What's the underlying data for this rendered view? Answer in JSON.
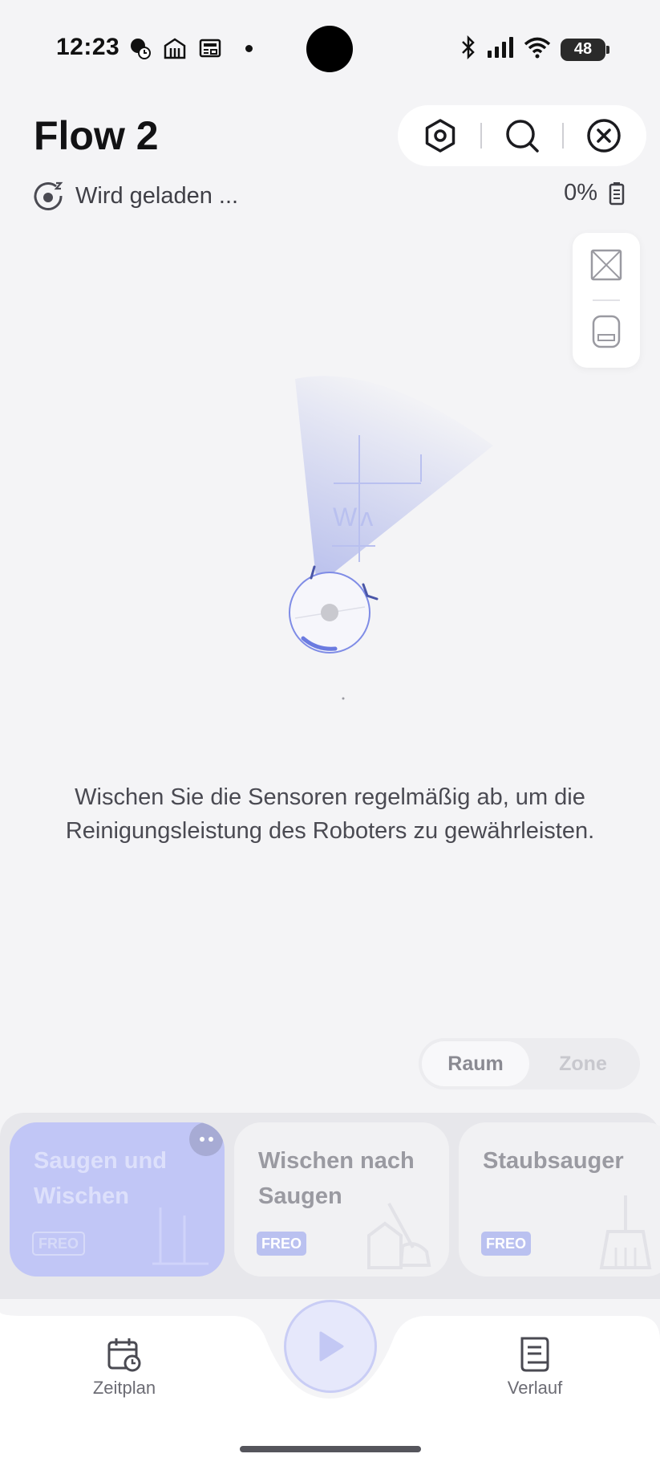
{
  "status_bar": {
    "time": "12:23",
    "battery_level": "48",
    "icons": [
      "notification-app-icon",
      "restaurant-app-icon",
      "news-app-icon",
      "bluetooth-icon",
      "cellular-signal-icon",
      "wifi-icon"
    ]
  },
  "header": {
    "title": "Flow 2",
    "status_text": "Wird geladen ...",
    "battery_percent": "0%",
    "actions": [
      "settings-icon",
      "search-icon",
      "close-icon"
    ]
  },
  "map": {
    "robot_accent": "#6b7be0",
    "scan_label": "Wʌ"
  },
  "tip": {
    "text": "Wischen Sie die Sensoren regelmäßig ab, um die Reinigungsleistung des Roboters zu gewährleisten."
  },
  "mode_toggle": {
    "options": [
      "Raum",
      "Zone"
    ],
    "selected": "Raum"
  },
  "cards": [
    {
      "title": "Saugen und Wischen",
      "badge": "FREO",
      "selected": true
    },
    {
      "title": "Wischen nach Saugen",
      "badge": "FREO",
      "selected": false
    },
    {
      "title": "Staubsauger",
      "badge": "FREO",
      "selected": false
    }
  ],
  "bottom_nav": {
    "schedule_label": "Zeitplan",
    "history_label": "Verlauf"
  },
  "colors": {
    "accent": "#6b7be0",
    "card_selected": "#c1c6f6",
    "background": "#f4f4f6"
  }
}
